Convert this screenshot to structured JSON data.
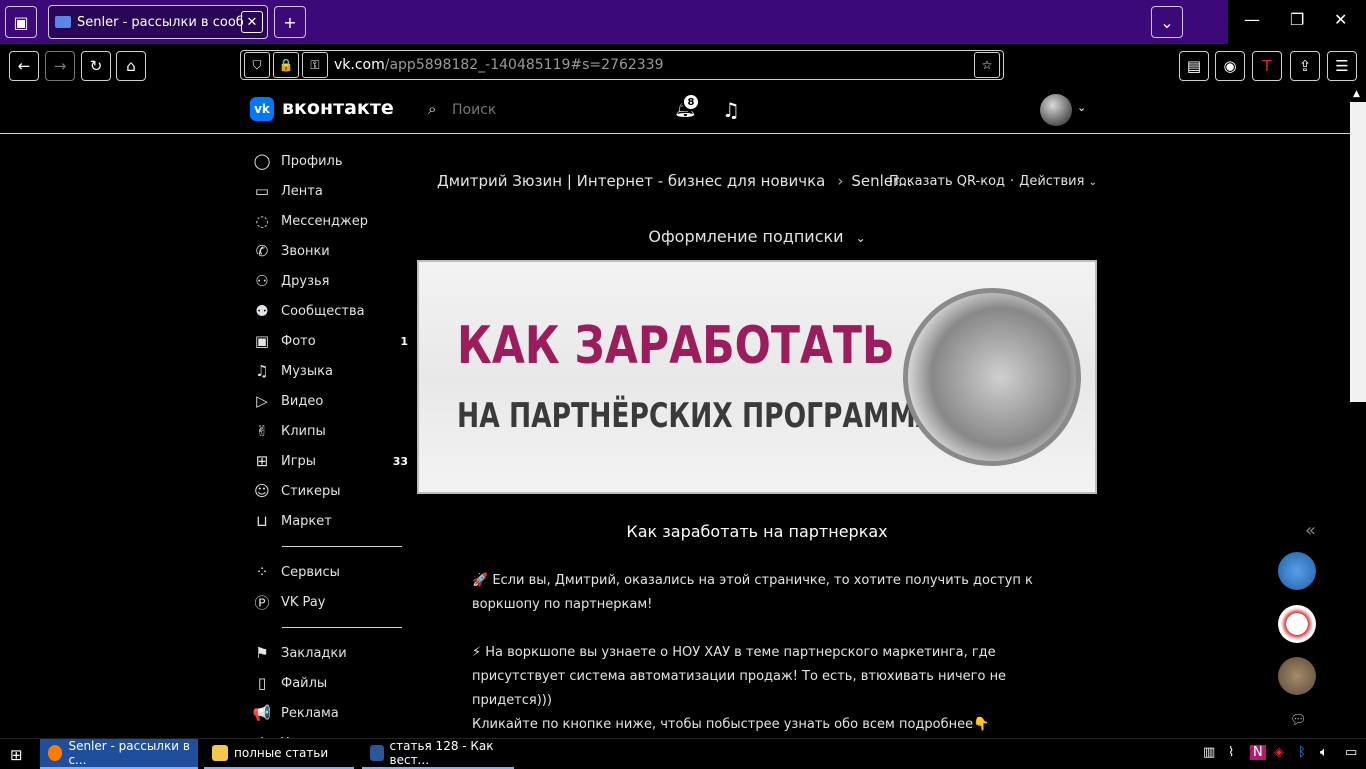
{
  "browser": {
    "tab_title": "Senler - рассылки в сообщес",
    "url_main": "vk.com",
    "url_rest": "/app5898182_-140485119#s=2762339",
    "new_tab_symbol": "+"
  },
  "vk": {
    "logo_mark": "vk",
    "logo_text": "вконтакте",
    "search_placeholder": "Поиск",
    "notifications_count": "8"
  },
  "nav": {
    "items": [
      {
        "label": "Профиль",
        "icon": "profile-icon",
        "glyph": "◯",
        "count": ""
      },
      {
        "label": "Лента",
        "icon": "feed-icon",
        "glyph": "▭",
        "count": ""
      },
      {
        "label": "Мессенджер",
        "icon": "messenger-icon",
        "glyph": "◌",
        "count": ""
      },
      {
        "label": "Звонки",
        "icon": "phone-icon",
        "glyph": "✆",
        "count": ""
      },
      {
        "label": "Друзья",
        "icon": "friends-icon",
        "glyph": "⚇",
        "count": ""
      },
      {
        "label": "Сообщества",
        "icon": "communities-icon",
        "glyph": "⚉",
        "count": ""
      },
      {
        "label": "Фото",
        "icon": "photo-icon",
        "glyph": "▣",
        "count": "1"
      },
      {
        "label": "Музыка",
        "icon": "music-icon",
        "glyph": "♫",
        "count": ""
      },
      {
        "label": "Видео",
        "icon": "video-icon",
        "glyph": "▷",
        "count": ""
      },
      {
        "label": "Клипы",
        "icon": "clips-icon",
        "glyph": "✌",
        "count": ""
      },
      {
        "label": "Игры",
        "icon": "games-icon",
        "glyph": "⊞",
        "count": "33"
      },
      {
        "label": "Стикеры",
        "icon": "stickers-icon",
        "glyph": "☺",
        "count": ""
      },
      {
        "label": "Маркет",
        "icon": "market-icon",
        "glyph": "⊔",
        "count": ""
      }
    ],
    "items2": [
      {
        "label": "Сервисы",
        "icon": "services-icon",
        "glyph": "⁘"
      },
      {
        "label": "VK Pay",
        "icon": "vkpay-icon",
        "glyph": "Ⓟ"
      }
    ],
    "items3": [
      {
        "label": "Закладки",
        "icon": "bookmarks-icon",
        "glyph": "⚑"
      },
      {
        "label": "Файлы",
        "icon": "files-icon",
        "glyph": "▯"
      },
      {
        "label": "Реклама",
        "icon": "ads-icon",
        "glyph": "📢"
      },
      {
        "label": "Управление",
        "icon": "manage-icon",
        "glyph": "⚙"
      }
    ]
  },
  "main": {
    "breadcrumb_group": "Дмитрий Зюзин | Интернет - бизнес для новичка",
    "breadcrumb_app": "Senler...",
    "show_qr": "Показать QR-код",
    "actions": "Действия",
    "subscription_label": "Оформление подписки",
    "banner_line1": "КАК ЗАРАБОТАТЬ",
    "banner_line2": "НА ПАРТНЁРСКИХ ПРОГРАММАХ",
    "page_title": "Как заработать на партнерках",
    "para1": "🚀 Если вы, Дмитрий, оказались на этой страничке, то хотите получить доступ к воркшопу по партнеркам!",
    "para2": "⚡ На воркшопе вы узнаете о НОУ ХАУ в теме партнерского маркетинга, где присутствует система автоматизации продаж! То есть, втюхивать ничего не придется)))",
    "para3": "Кликайте по кнопке ниже, чтобы побыстрее узнать обо всем подробнее👇"
  },
  "taskbar": {
    "items": [
      {
        "label": "Senler - рассылки в с...",
        "color": "#ff7a00"
      },
      {
        "label": "полные статьи",
        "color": "#f2c94c"
      },
      {
        "label": "статья 128 - Как вест...",
        "color": "#2b579a"
      }
    ]
  },
  "colors": {
    "tabbar_bg": "#3b0a78",
    "vk_blue": "#0077ff",
    "banner_accent": "#9b1d5c"
  }
}
